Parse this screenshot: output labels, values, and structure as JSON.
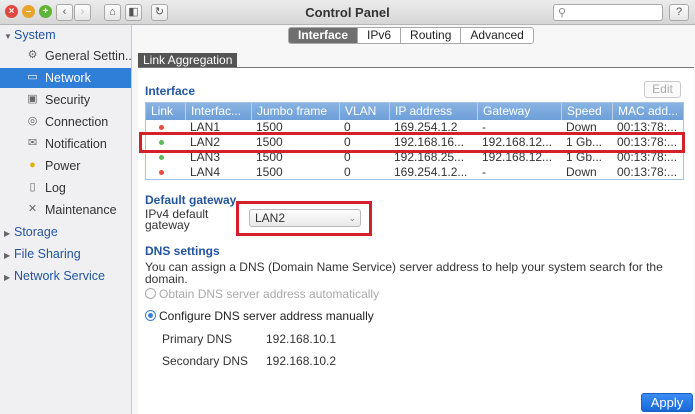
{
  "window": {
    "title": "Control Panel",
    "search_placeholder": "",
    "help_label": "?"
  },
  "sidebar": {
    "system": "System",
    "items": [
      {
        "label": "General Settin...",
        "icon": "gear-icon"
      },
      {
        "label": "Network",
        "icon": "network-icon"
      },
      {
        "label": "Security",
        "icon": "lock-icon"
      },
      {
        "label": "Connection",
        "icon": "globe-icon"
      },
      {
        "label": "Notification",
        "icon": "envelope-icon"
      },
      {
        "label": "Power",
        "icon": "lightbulb-icon"
      },
      {
        "label": "Log",
        "icon": "document-icon"
      },
      {
        "label": "Maintenance",
        "icon": "tools-icon"
      }
    ],
    "storage": "Storage",
    "file_sharing": "File Sharing",
    "network_service": "Network Service"
  },
  "tabs": [
    "Interface",
    "IPv6",
    "Routing",
    "Advanced"
  ],
  "subtab": "Link Aggregation",
  "interface_section": {
    "title": "Interface",
    "edit_label": "Edit",
    "columns": [
      "Link",
      "Interfac...",
      "Jumbo frame",
      "VLAN",
      "IP address",
      "Gateway",
      "Speed",
      "MAC add..."
    ],
    "rows": [
      {
        "status_color": "#e74c3c",
        "name": "LAN1",
        "jumbo": "1500",
        "vlan": "0",
        "ip": "169.254.1.2",
        "gateway": "-",
        "speed": "Down",
        "mac": "00:13:78:..."
      },
      {
        "status_color": "#5cb85c",
        "name": "LAN2",
        "jumbo": "1500",
        "vlan": "0",
        "ip": "192.168.16...",
        "gateway": "192.168.12...",
        "speed": "1 Gb...",
        "mac": "00:13:78:..."
      },
      {
        "status_color": "#5cb85c",
        "name": "LAN3",
        "jumbo": "1500",
        "vlan": "0",
        "ip": "192.168.25...",
        "gateway": "192.168.12...",
        "speed": "1 Gb...",
        "mac": "00:13:78:..."
      },
      {
        "status_color": "#e74c3c",
        "name": "LAN4",
        "jumbo": "1500",
        "vlan": "0",
        "ip": "169.254.1.2...",
        "gateway": "-",
        "speed": "Down",
        "mac": "00:13:78:..."
      }
    ]
  },
  "gateway_section": {
    "title": "Default gateway",
    "label_line1": "IPv4 default",
    "label_line2": "gateway",
    "selected": "LAN2"
  },
  "dns_section": {
    "title": "DNS settings",
    "description": "You can assign a DNS (Domain Name Service) server address to help your system search for the domain.",
    "option_auto": "Obtain DNS server address automatically",
    "option_manual": "Configure DNS server address manually",
    "primary_label": "Primary DNS",
    "primary_value": "192.168.10.1",
    "secondary_label": "Secondary DNS",
    "secondary_value": "192.168.10.2"
  },
  "apply_label": "Apply",
  "colors": {
    "accent": "#2f7ed8",
    "highlight": "#d4202a"
  }
}
